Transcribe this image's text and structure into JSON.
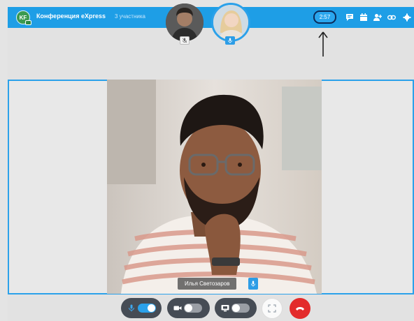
{
  "header": {
    "avatar_initials": "KF",
    "title": "Конференция eXpress",
    "participants": "3 участника",
    "timer": "2:57",
    "icons": [
      "chat-icon",
      "calendar-icon",
      "add-user-icon",
      "link-icon",
      "settings-icon"
    ]
  },
  "participants_bar": {
    "avatars": [
      {
        "name": "participant-avatar-1",
        "mic": "muted"
      },
      {
        "name": "participant-avatar-2",
        "mic": "active"
      }
    ]
  },
  "stage": {
    "speaker_name": "Илья Светозаров",
    "speaker_mic": "active"
  },
  "controls": {
    "microphone": {
      "icon": "mic-icon",
      "enabled": true
    },
    "camera": {
      "icon": "camera-icon",
      "enabled": false
    },
    "screen_share": {
      "icon": "screen-share-icon",
      "enabled": false
    },
    "fullscreen": {
      "icon": "fullscreen-icon"
    },
    "hangup": {
      "icon": "hangup-icon"
    }
  },
  "colors": {
    "header_blue": "#1e9ee6",
    "accent_blue": "#2ba1ea",
    "control_dark": "#464c55",
    "hangup_red": "#e32b2b"
  }
}
